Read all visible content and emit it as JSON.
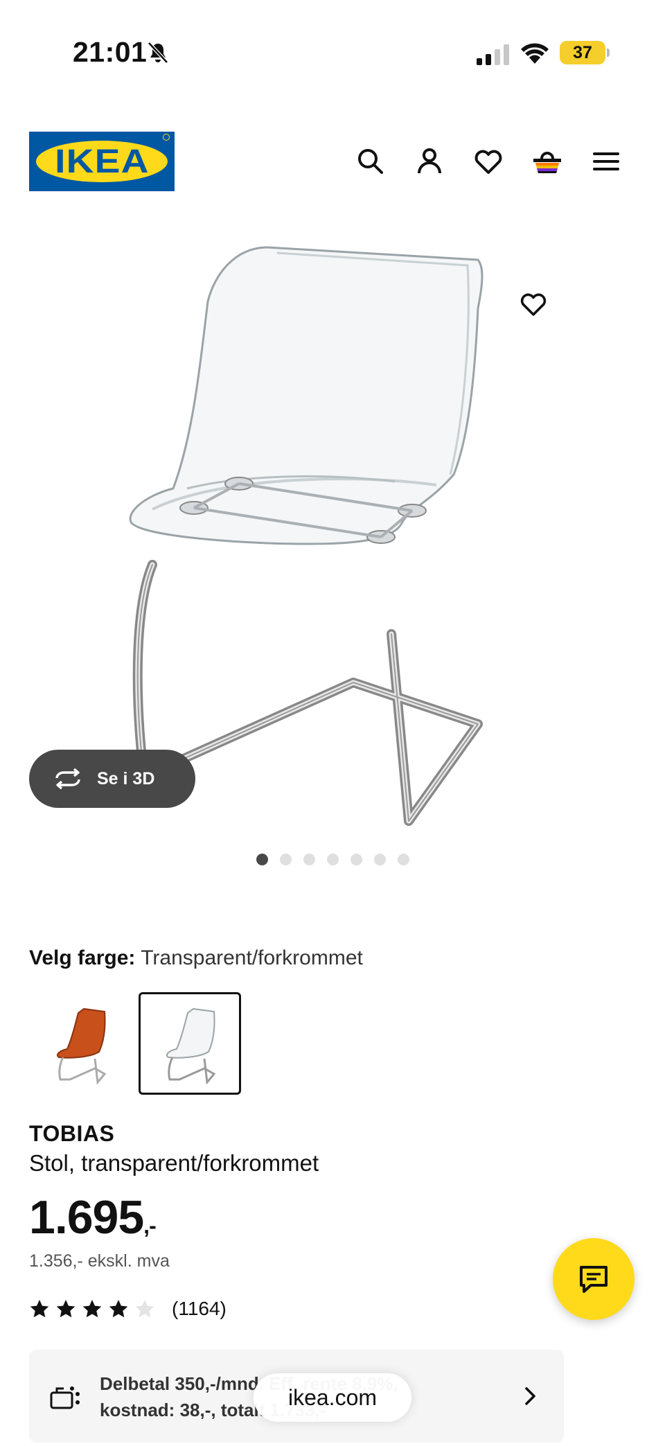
{
  "status_bar": {
    "time": "21:01",
    "battery": "37"
  },
  "header": {
    "logo_text": "IKEA"
  },
  "gallery": {
    "see_3d_label": "Se i 3D",
    "dot_count": 7,
    "active_dot": 0
  },
  "color_picker": {
    "label": "Velg farge:",
    "selected_value": "Transparent/forkrommet"
  },
  "product": {
    "name": "TOBIAS",
    "description": "Stol, transparent/forkrommet",
    "price_main": "1.695",
    "price_suffix": ",-",
    "price_ex_vat": "1.356,- ekskl. mva",
    "rating_stars": 4,
    "rating_max": 5,
    "review_count": "(1164)"
  },
  "finance": {
    "line1": "Delbetal 350,-/mnd. Eff. rente 8.9%,",
    "line2": "kostnad: 38,-, totalt 1.733,-"
  },
  "browser": {
    "url": "ikea.com"
  },
  "colors": {
    "ikea_blue": "#0058a3",
    "ikea_yellow": "#ffda1a",
    "dark_button": "#484848"
  }
}
